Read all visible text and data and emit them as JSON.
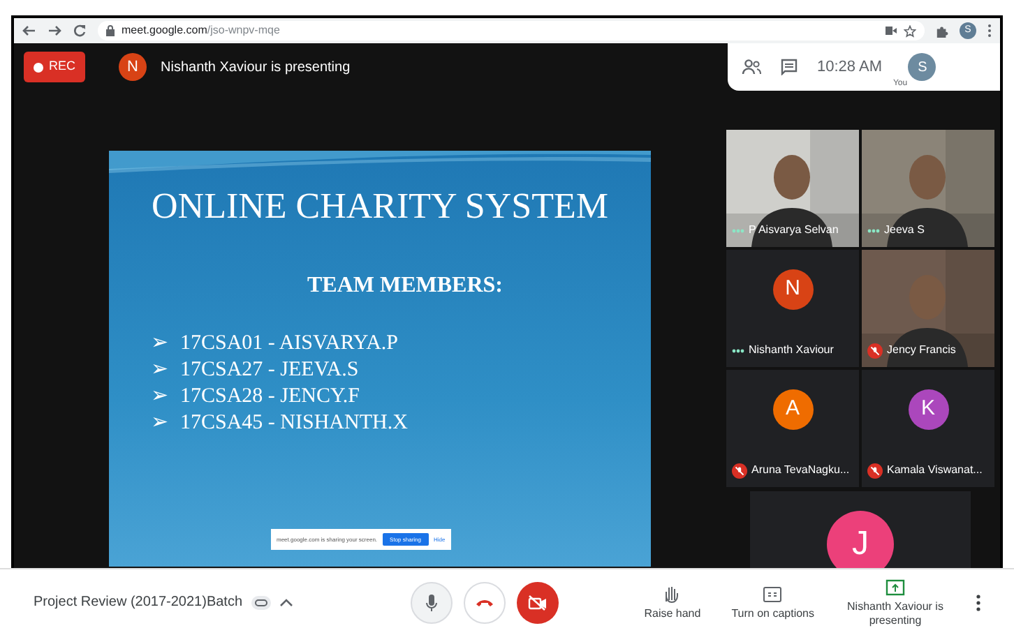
{
  "browser": {
    "url_host": "meet.google.com",
    "url_path": "/jso-wnpv-mqe",
    "profile_initial": "S"
  },
  "top_bar": {
    "rec_label": "REC",
    "presenter_initial": "N",
    "presenter_text": "Nishanth Xaviour is presenting",
    "time": "10:28 AM",
    "self_initial": "S",
    "self_label": "You"
  },
  "slide": {
    "title": "ONLINE CHARITY SYSTEM",
    "subtitle": "TEAM MEMBERS:",
    "members": [
      {
        "bullet": "➢",
        "text": "17CSA01 - AISVARYA.P"
      },
      {
        "bullet": "➢",
        "text": "17CSA27 - JEEVA.S"
      },
      {
        "bullet": "➢",
        "text": "17CSA28 - JENCY.F"
      },
      {
        "bullet": "➢",
        "text": "17CSA45 - NISHANTH.X"
      }
    ],
    "share_notice": {
      "message": "meet.google.com is sharing your screen.",
      "stop_label": "Stop sharing",
      "hide_label": "Hide"
    }
  },
  "participants": [
    {
      "kind": "video",
      "name": "P Aisvarya Selvan",
      "muted": false
    },
    {
      "kind": "video",
      "name": "Jeeva S",
      "muted": false
    },
    {
      "kind": "avatar",
      "name": "Nishanth Xaviour",
      "initial": "N",
      "color": "#d84315",
      "muted": false
    },
    {
      "kind": "video",
      "name": "Jency Francis",
      "muted": true
    },
    {
      "kind": "avatar",
      "name": "Aruna TevaNagku...",
      "initial": "A",
      "color": "#ef6c00",
      "muted": true
    },
    {
      "kind": "avatar",
      "name": "Kamala Viswanat...",
      "initial": "K",
      "color": "#ab47bc",
      "muted": true
    },
    {
      "kind": "avatar",
      "initial": "J",
      "color": "#ec407a"
    }
  ],
  "bottom_bar": {
    "meeting_name": "Project Review (2017-2021)Batch",
    "camera_off": true,
    "actions": [
      {
        "label": "Raise hand",
        "kind": "hand"
      },
      {
        "label": "Turn on captions",
        "kind": "captions"
      },
      {
        "label": "Nishanth Xaviour is presenting",
        "kind": "present"
      }
    ]
  }
}
